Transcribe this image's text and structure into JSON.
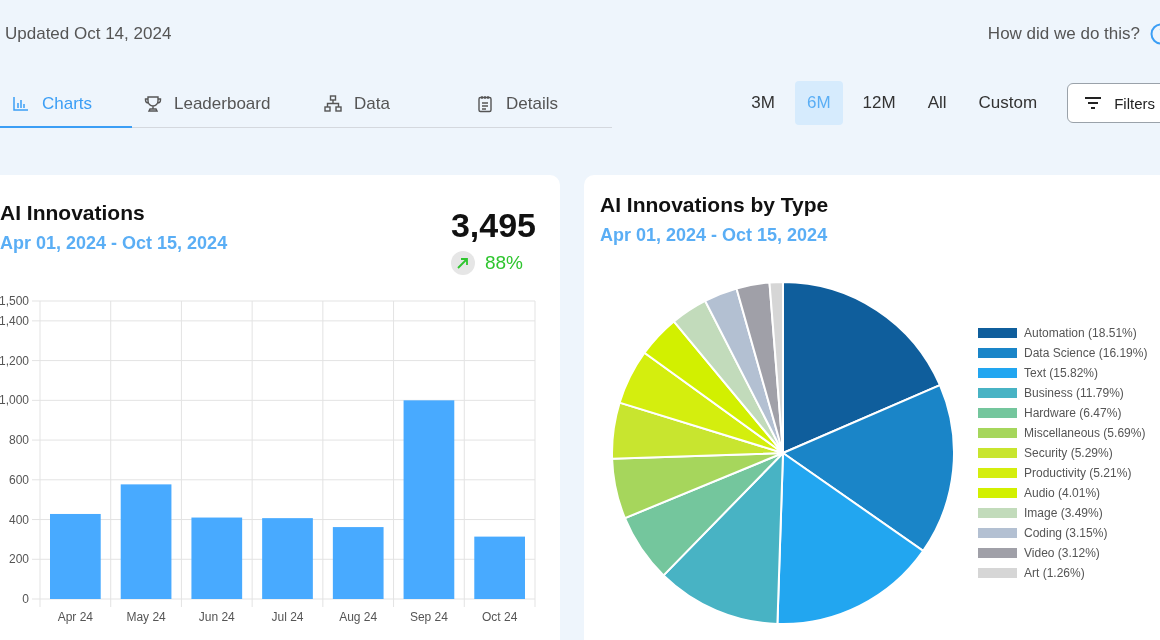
{
  "header": {
    "updated": "Updated Oct 14, 2024",
    "help_link": "How did we do this?"
  },
  "tabs": [
    {
      "label": "Charts",
      "selected": true
    },
    {
      "label": "Leaderboard",
      "selected": false
    },
    {
      "label": "Data",
      "selected": false
    },
    {
      "label": "Details",
      "selected": false
    }
  ],
  "ranges": [
    {
      "label": "3M",
      "selected": false
    },
    {
      "label": "6M",
      "selected": true
    },
    {
      "label": "12M",
      "selected": false
    },
    {
      "label": "All",
      "selected": false
    },
    {
      "label": "Custom",
      "selected": false
    }
  ],
  "filters_button": "Filters",
  "innovations_card": {
    "title": "AI Innovations",
    "date_range": "Apr 01, 2024 - Oct 15, 2024",
    "total": "3,495",
    "change": "88%",
    "chart_data": {
      "type": "bar",
      "categories": [
        "Apr 24",
        "May 24",
        "Jun 24",
        "Jul 24",
        "Aug 24",
        "Sep 24",
        "Oct 24"
      ],
      "series": [
        {
          "color": "#48aaff",
          "values": [
            428,
            577,
            410,
            407,
            362,
            1000,
            314
          ]
        }
      ],
      "grid": true,
      "ylim": [
        0,
        1500
      ],
      "yticks": [
        0,
        200,
        400,
        600,
        800,
        {
          "value": 1000,
          "label": "1,000"
        },
        {
          "value": 1200,
          "label": "1,200"
        },
        {
          "value": 1400,
          "label": "1,400"
        },
        {
          "value": 1500,
          "label": "1,500"
        }
      ]
    }
  },
  "type_card": {
    "title": "AI Innovations by Type",
    "date_range": "Apr 01, 2024 - Oct 15, 2024",
    "chart_data": {
      "type": "pie",
      "categories": [
        "Automation (18.51%)",
        "Data Science (16.19%)",
        "Text (15.82%)",
        "Business (11.79%)",
        "Hardware (6.47%)",
        "Miscellaneous (5.69%)",
        "Security (5.29%)",
        "Productivity (5.21%)",
        "Audio (4.01%)",
        "Image (3.49%)",
        "Coding (3.15%)",
        "Video (3.12%)",
        "Art (1.26%)"
      ],
      "values": [
        18.51,
        16.19,
        15.82,
        11.79,
        6.47,
        5.69,
        5.29,
        5.21,
        4.01,
        3.49,
        3.15,
        3.12,
        1.26
      ],
      "colors": [
        "#0f5e9c",
        "#1a85c8",
        "#22a6f0",
        "#48b3c4",
        "#74c69d",
        "#a6d65c",
        "#c8e52f",
        "#d4ee0e",
        "#d2f000",
        "#c2dbbb",
        "#b3c0d2",
        "#a0a0a8",
        "#d6d6d6"
      ]
    }
  }
}
